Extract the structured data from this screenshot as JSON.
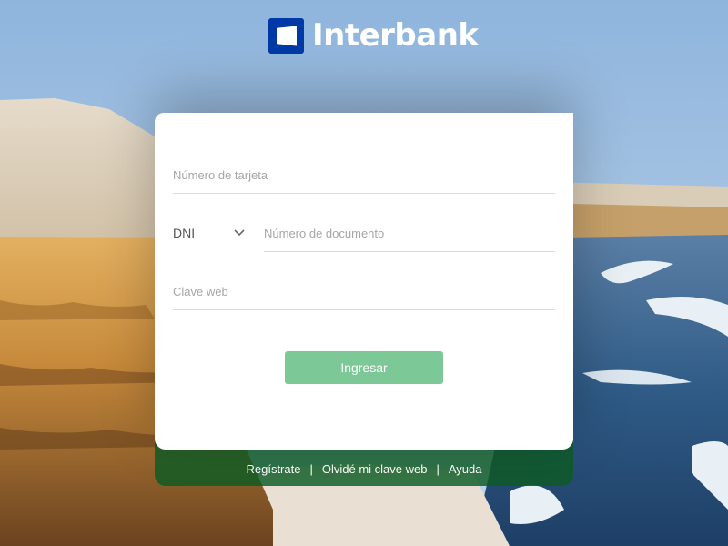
{
  "brand": {
    "name": "Interbank",
    "logo_icon": "interbank-logo-icon",
    "color": "#0039a6"
  },
  "login_form": {
    "card_number": {
      "placeholder": "Número de tarjeta",
      "value": ""
    },
    "document_type": {
      "selected": "DNI",
      "icon": "chevron-down-icon"
    },
    "document_number": {
      "placeholder": "Número de documento",
      "value": ""
    },
    "web_password": {
      "placeholder": "Clave web",
      "value": ""
    },
    "submit_label": "Ingresar",
    "submit_color": "#7cc896"
  },
  "footer": {
    "links": [
      "Regístrate",
      "Olvidé mi clave web",
      "Ayuda"
    ],
    "separator": "|",
    "color": "#0e5c24"
  }
}
